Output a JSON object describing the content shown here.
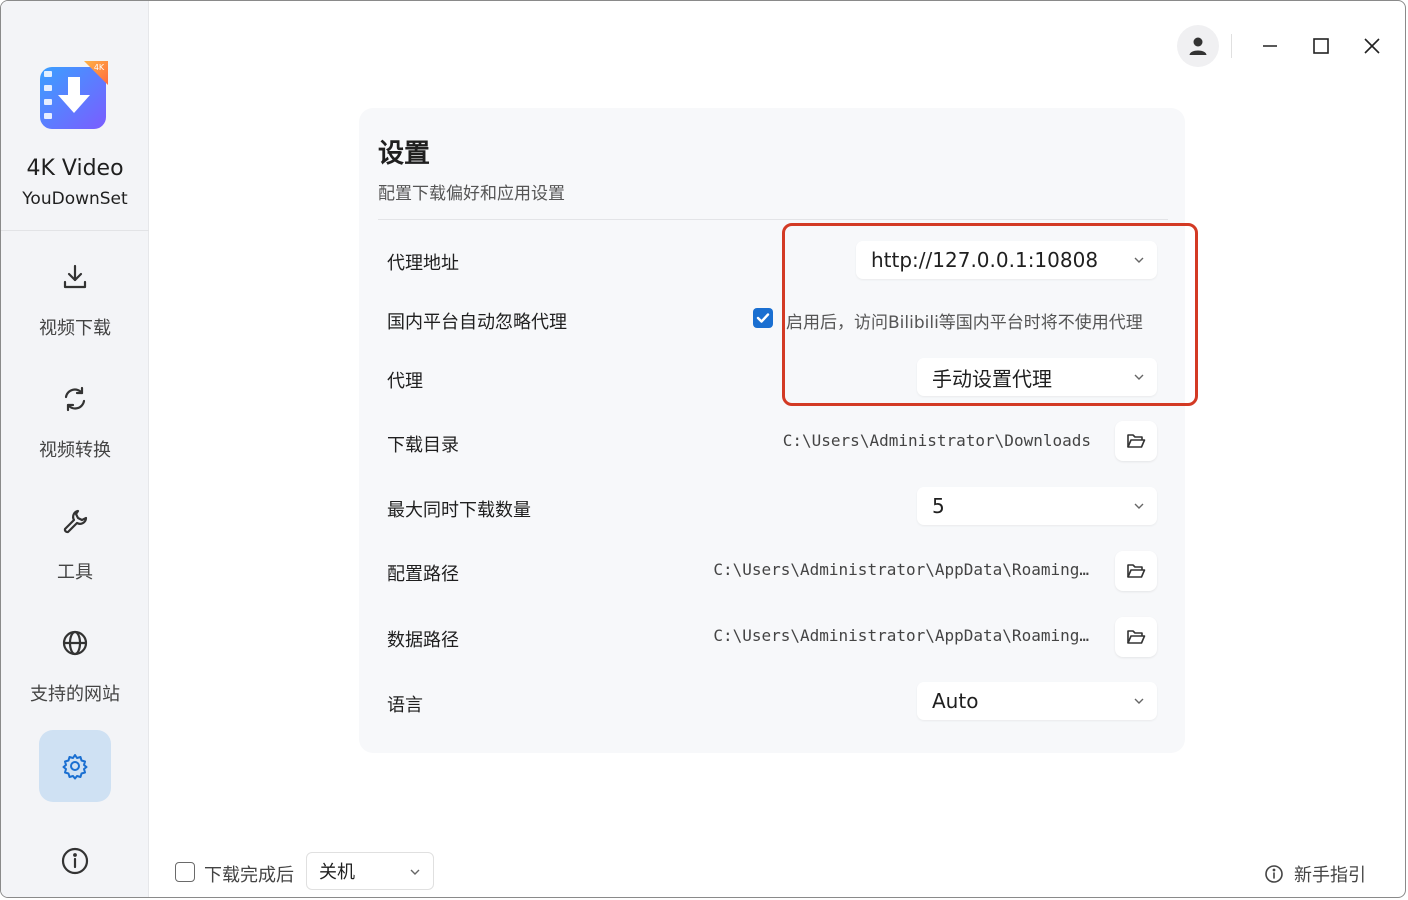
{
  "app": {
    "name": "4K Video",
    "subtitle": "YouDownSet",
    "logo_badge": "4K"
  },
  "sidebar": {
    "items": [
      {
        "label": "视频下载",
        "icon": "download-icon"
      },
      {
        "label": "视频转换",
        "icon": "convert-icon"
      },
      {
        "label": "工具",
        "icon": "wrench-icon"
      },
      {
        "label": "支持的网站",
        "icon": "globe-icon"
      }
    ],
    "active_icon": "gear-icon",
    "footer_icon": "info-icon"
  },
  "settings": {
    "title": "设置",
    "subtitle": "配置下载偏好和应用设置",
    "proxy_address_label": "代理地址",
    "proxy_address_value": "http://127.0.0.1:10808",
    "ignore_proxy_label": "国内平台自动忽略代理",
    "ignore_proxy_checked": true,
    "ignore_proxy_desc": "启用后，访问Bilibili等国内平台时将不使用代理",
    "proxy_label": "代理",
    "proxy_value": "手动设置代理",
    "download_dir_label": "下载目录",
    "download_dir_value": "C:\\Users\\Administrator\\Downloads",
    "max_downloads_label": "最大同时下载数量",
    "max_downloads_value": "5",
    "config_path_label": "配置路径",
    "config_path_value": "C:\\Users\\Administrator\\AppData\\Roaming…",
    "data_path_label": "数据路径",
    "data_path_value": "C:\\Users\\Administrator\\AppData\\Roaming…",
    "language_label": "语言",
    "language_value": "Auto"
  },
  "bottom": {
    "after_download_checked": false,
    "after_download_label": "下载完成后",
    "after_download_action": "关机",
    "guide_label": "新手指引"
  },
  "colors": {
    "accent": "#1a6fd1",
    "highlight": "#d33a24",
    "active_nav_bg": "#cfe1f3"
  }
}
